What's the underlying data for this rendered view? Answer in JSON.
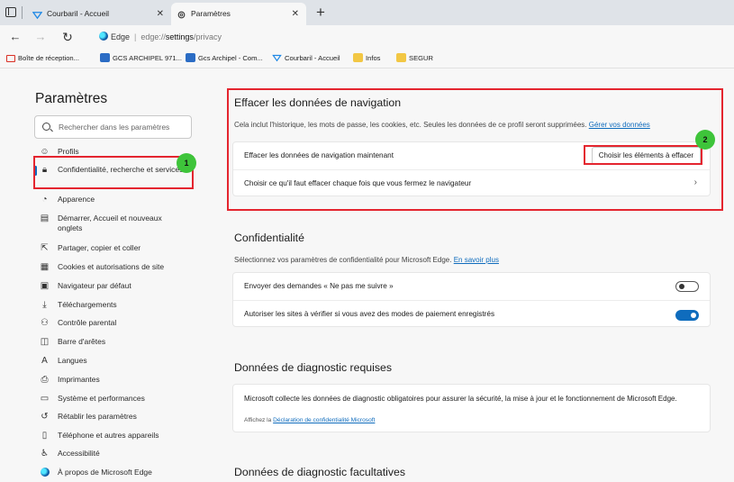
{
  "colors": {
    "accent": "#0f6cbd",
    "highlight_red": "#e4252f",
    "badge_green": "#3ec43a"
  },
  "tabs": [
    {
      "label": "Courbaril - Accueil",
      "icon": "courbaril-favicon"
    },
    {
      "label": "Paramètres",
      "icon": "gear-icon"
    }
  ],
  "address": {
    "site": "Edge",
    "url_prefix": "edge://",
    "url_strong": "settings",
    "url_rest": "/privacy"
  },
  "favorites": [
    {
      "label": "Boîte de réception...",
      "icon": "gmail-icon"
    },
    {
      "label": "GCS ARCHIPEL 971...",
      "icon": "app-icon"
    },
    {
      "label": "Gcs Archipel - Com...",
      "icon": "app-icon"
    },
    {
      "label": "Courbaril - Accueil",
      "icon": "courbaril-favicon"
    },
    {
      "label": "Infos",
      "icon": "folder-icon"
    },
    {
      "label": "SEGUR",
      "icon": "folder-icon"
    }
  ],
  "sidebar": {
    "title": "Paramètres",
    "search_placeholder": "Rechercher dans les paramètres",
    "items": [
      {
        "label": "Profils",
        "icon": "profile-icon"
      },
      {
        "label": "Confidentialité, recherche et services",
        "icon": "lock-icon"
      },
      {
        "label": "Apparence",
        "icon": "appearance-icon"
      },
      {
        "label": "Démarrer, Accueil et nouveaux onglets",
        "icon": "home-icon"
      },
      {
        "label": "Partager, copier et coller",
        "icon": "share-icon"
      },
      {
        "label": "Cookies et autorisations de site",
        "icon": "cookies-icon"
      },
      {
        "label": "Navigateur par défaut",
        "icon": "browser-icon"
      },
      {
        "label": "Téléchargements",
        "icon": "download-icon"
      },
      {
        "label": "Contrôle parental",
        "icon": "family-icon"
      },
      {
        "label": "Barre d'arêtes",
        "icon": "sidebar-icon"
      },
      {
        "label": "Langues",
        "icon": "language-icon"
      },
      {
        "label": "Imprimantes",
        "icon": "printer-icon"
      },
      {
        "label": "Système et performances",
        "icon": "system-icon"
      },
      {
        "label": "Rétablir les paramètres",
        "icon": "reset-icon"
      },
      {
        "label": "Téléphone et autres appareils",
        "icon": "phone-icon"
      },
      {
        "label": "Accessibilité",
        "icon": "accessibility-icon"
      },
      {
        "label": "À propos de Microsoft Edge",
        "icon": "edge-icon"
      }
    ]
  },
  "badges": {
    "one": "1",
    "two": "2"
  },
  "clear_data": {
    "title": "Effacer les données de navigation",
    "description": "Cela inclut l'historique, les mots de passe, les cookies, etc. Seules les données de ce profil seront supprimées.",
    "manage_link": "Gérer vos données",
    "row_now": "Effacer les données de navigation maintenant",
    "choose_button": "Choisir les éléments à effacer",
    "row_on_close": "Choisir ce qu'il faut effacer chaque fois que vous fermez le navigateur"
  },
  "privacy": {
    "title": "Confidentialité",
    "description": "Sélectionnez vos paramètres de confidentialité pour Microsoft Edge.",
    "learn_more": "En savoir plus",
    "dnt_label": "Envoyer des demandes « Ne pas me suivre »",
    "dnt_on": false,
    "payment_label": "Autoriser les sites à vérifier si vous avez des modes de paiement enregistrés",
    "payment_on": true
  },
  "diagnostics_required": {
    "title": "Données de diagnostic requises",
    "text": "Microsoft collecte les données de diagnostic obligatoires pour assurer la sécurité, la mise à jour et le fonctionnement de Microsoft Edge.",
    "small_prefix": "Affichez la",
    "small_link": "Déclaration de confidentialité Microsoft"
  },
  "diagnostics_optional": {
    "title": "Données de diagnostic facultatives"
  }
}
